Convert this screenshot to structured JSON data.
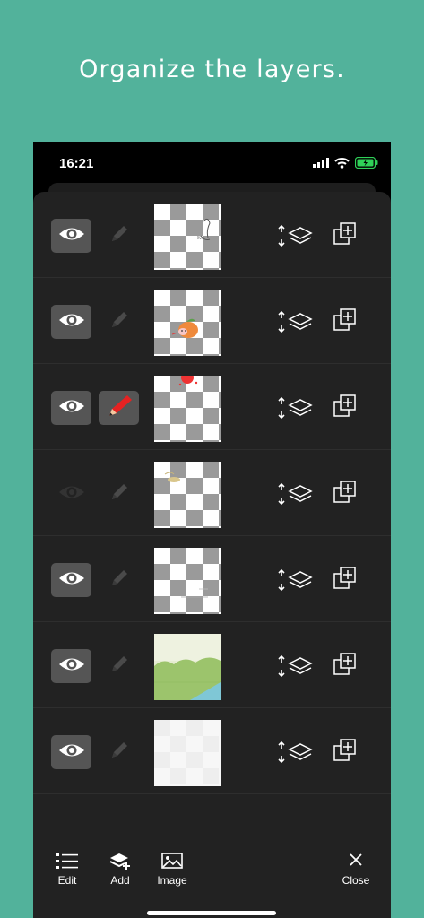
{
  "headline": "Organize the layers.",
  "status": {
    "time": "16:21"
  },
  "layers": [
    {
      "visible": true,
      "editing": false,
      "content": "sketch"
    },
    {
      "visible": true,
      "editing": false,
      "content": "character"
    },
    {
      "visible": true,
      "editing": true,
      "content": "red-dot"
    },
    {
      "visible": false,
      "editing": false,
      "content": "small-figure"
    },
    {
      "visible": true,
      "editing": false,
      "content": "faint-lines"
    },
    {
      "visible": true,
      "editing": false,
      "content": "landscape"
    },
    {
      "visible": true,
      "editing": false,
      "content": "white-base"
    }
  ],
  "toolbar": {
    "edit": "Edit",
    "add": "Add",
    "image": "Image",
    "close": "Close"
  },
  "icons": {
    "visibility": "eye-icon",
    "edit_target": "pencil-icon",
    "merge": "merge-down-icon",
    "duplicate": "duplicate-icon"
  }
}
